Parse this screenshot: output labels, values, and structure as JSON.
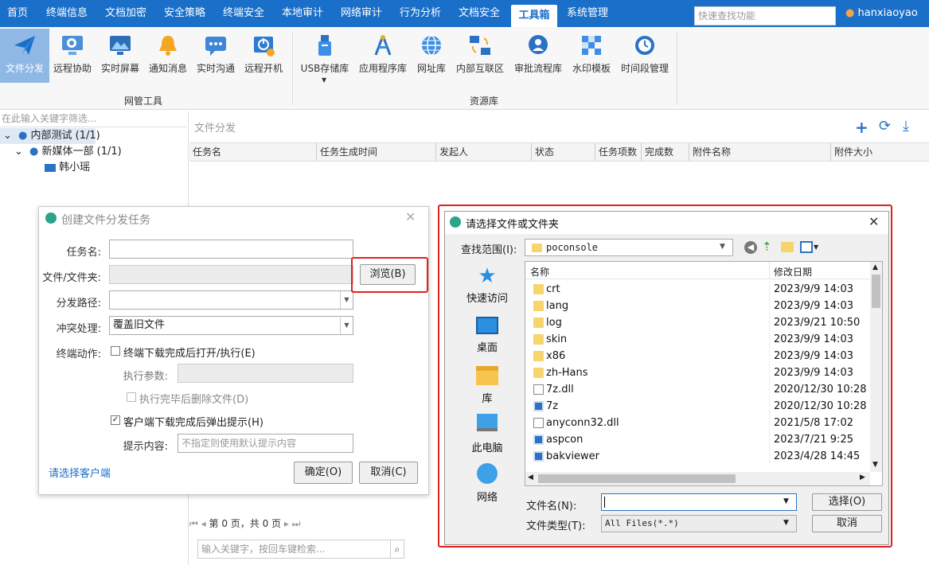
{
  "menu": {
    "items": [
      "首页",
      "终端信息",
      "文档加密",
      "安全策略",
      "终端安全",
      "本地审计",
      "网络审计",
      "行为分析",
      "文档安全",
      "工具箱",
      "系统管理"
    ],
    "active_index": 9,
    "search_placeholder": "快速查找功能",
    "user": "hanxiaoyao"
  },
  "ribbon": {
    "group1_label": "网管工具",
    "group2_label": "资源库",
    "buttons": [
      {
        "label": "文件分发",
        "icon": "paper-plane-icon"
      },
      {
        "label": "远程协助",
        "icon": "remote-assist-icon"
      },
      {
        "label": "实时屏幕",
        "icon": "screen-icon"
      },
      {
        "label": "通知消息",
        "icon": "bell-icon"
      },
      {
        "label": "实时沟通",
        "icon": "chat-icon"
      },
      {
        "label": "远程开机",
        "icon": "power-on-icon"
      },
      {
        "label": "USB存储库",
        "icon": "usb-icon"
      },
      {
        "label": "应用程序库",
        "icon": "app-library-icon"
      },
      {
        "label": "网址库",
        "icon": "globe-icon"
      },
      {
        "label": "内部互联区",
        "icon": "interconnect-icon"
      },
      {
        "label": "审批流程库",
        "icon": "approval-icon"
      },
      {
        "label": "水印模板",
        "icon": "watermark-icon"
      },
      {
        "label": "时间段管理",
        "icon": "clock-icon"
      }
    ]
  },
  "tree": {
    "filter_placeholder": "在此输入关键字筛选...",
    "nodes": [
      "内部测试 (1/1)",
      "新媒体一部 (1/1)",
      "韩小瑶"
    ]
  },
  "main": {
    "title": "文件分发",
    "columns": [
      "任务名",
      "任务生成时间",
      "发起人",
      "状态",
      "任务项数",
      "完成数",
      "附件名称",
      "附件大小"
    ],
    "pager": "第 0 页，共 0 页",
    "search_placeholder": "输入关键字，按回车键检索..."
  },
  "task_dialog": {
    "title": "创建文件分发任务",
    "task_name_label": "任务名:",
    "file_label": "文件/文件夹:",
    "browse_button": "浏览(B)",
    "path_label": "分发路径:",
    "conflict_label": "冲突处理:",
    "conflict_value": "覆盖旧文件",
    "terminal_action_label": "终端动作:",
    "open_after_download": "终端下载完成后打开/执行(E)",
    "exec_params_label": "执行参数:",
    "delete_after_exec": "执行完毕后删除文件(D)",
    "popup_after_download": "客户端下载完成后弹出提示(H)",
    "hint_label": "提示内容:",
    "hint_placeholder": "不指定则使用默认提示内容",
    "select_clients_link": "请选择客户端",
    "ok_button": "确定(O)",
    "cancel_button": "取消(C)"
  },
  "file_dialog": {
    "title": "请选择文件或文件夹",
    "look_in_label": "查找范围(I):",
    "look_in_value": "poconsole",
    "places": [
      "快速访问",
      "桌面",
      "库",
      "此电脑",
      "网络"
    ],
    "col_name": "名称",
    "col_date": "修改日期",
    "files": [
      {
        "name": "crt",
        "date": "2023/9/9 14:03",
        "kind": "folder"
      },
      {
        "name": "lang",
        "date": "2023/9/9 14:03",
        "kind": "folder"
      },
      {
        "name": "log",
        "date": "2023/9/21 10:50",
        "kind": "folder"
      },
      {
        "name": "skin",
        "date": "2023/9/9 14:03",
        "kind": "folder"
      },
      {
        "name": "x86",
        "date": "2023/9/9 14:03",
        "kind": "folder"
      },
      {
        "name": "zh-Hans",
        "date": "2023/9/9 14:03",
        "kind": "folder"
      },
      {
        "name": "7z.dll",
        "date": "2020/12/30 10:28",
        "kind": "dll"
      },
      {
        "name": "7z",
        "date": "2020/12/30 10:28",
        "kind": "exe"
      },
      {
        "name": "anyconn32.dll",
        "date": "2021/5/8 17:02",
        "kind": "dll"
      },
      {
        "name": "aspcon",
        "date": "2023/7/21 9:25",
        "kind": "exe"
      },
      {
        "name": "bakviewer",
        "date": "2023/4/28 14:45",
        "kind": "exe"
      }
    ],
    "filename_label": "文件名(N):",
    "filetype_label": "文件类型(T):",
    "filetype_value": "All Files(*.*)",
    "select_button": "选择(O)",
    "cancel_button": "取消"
  }
}
